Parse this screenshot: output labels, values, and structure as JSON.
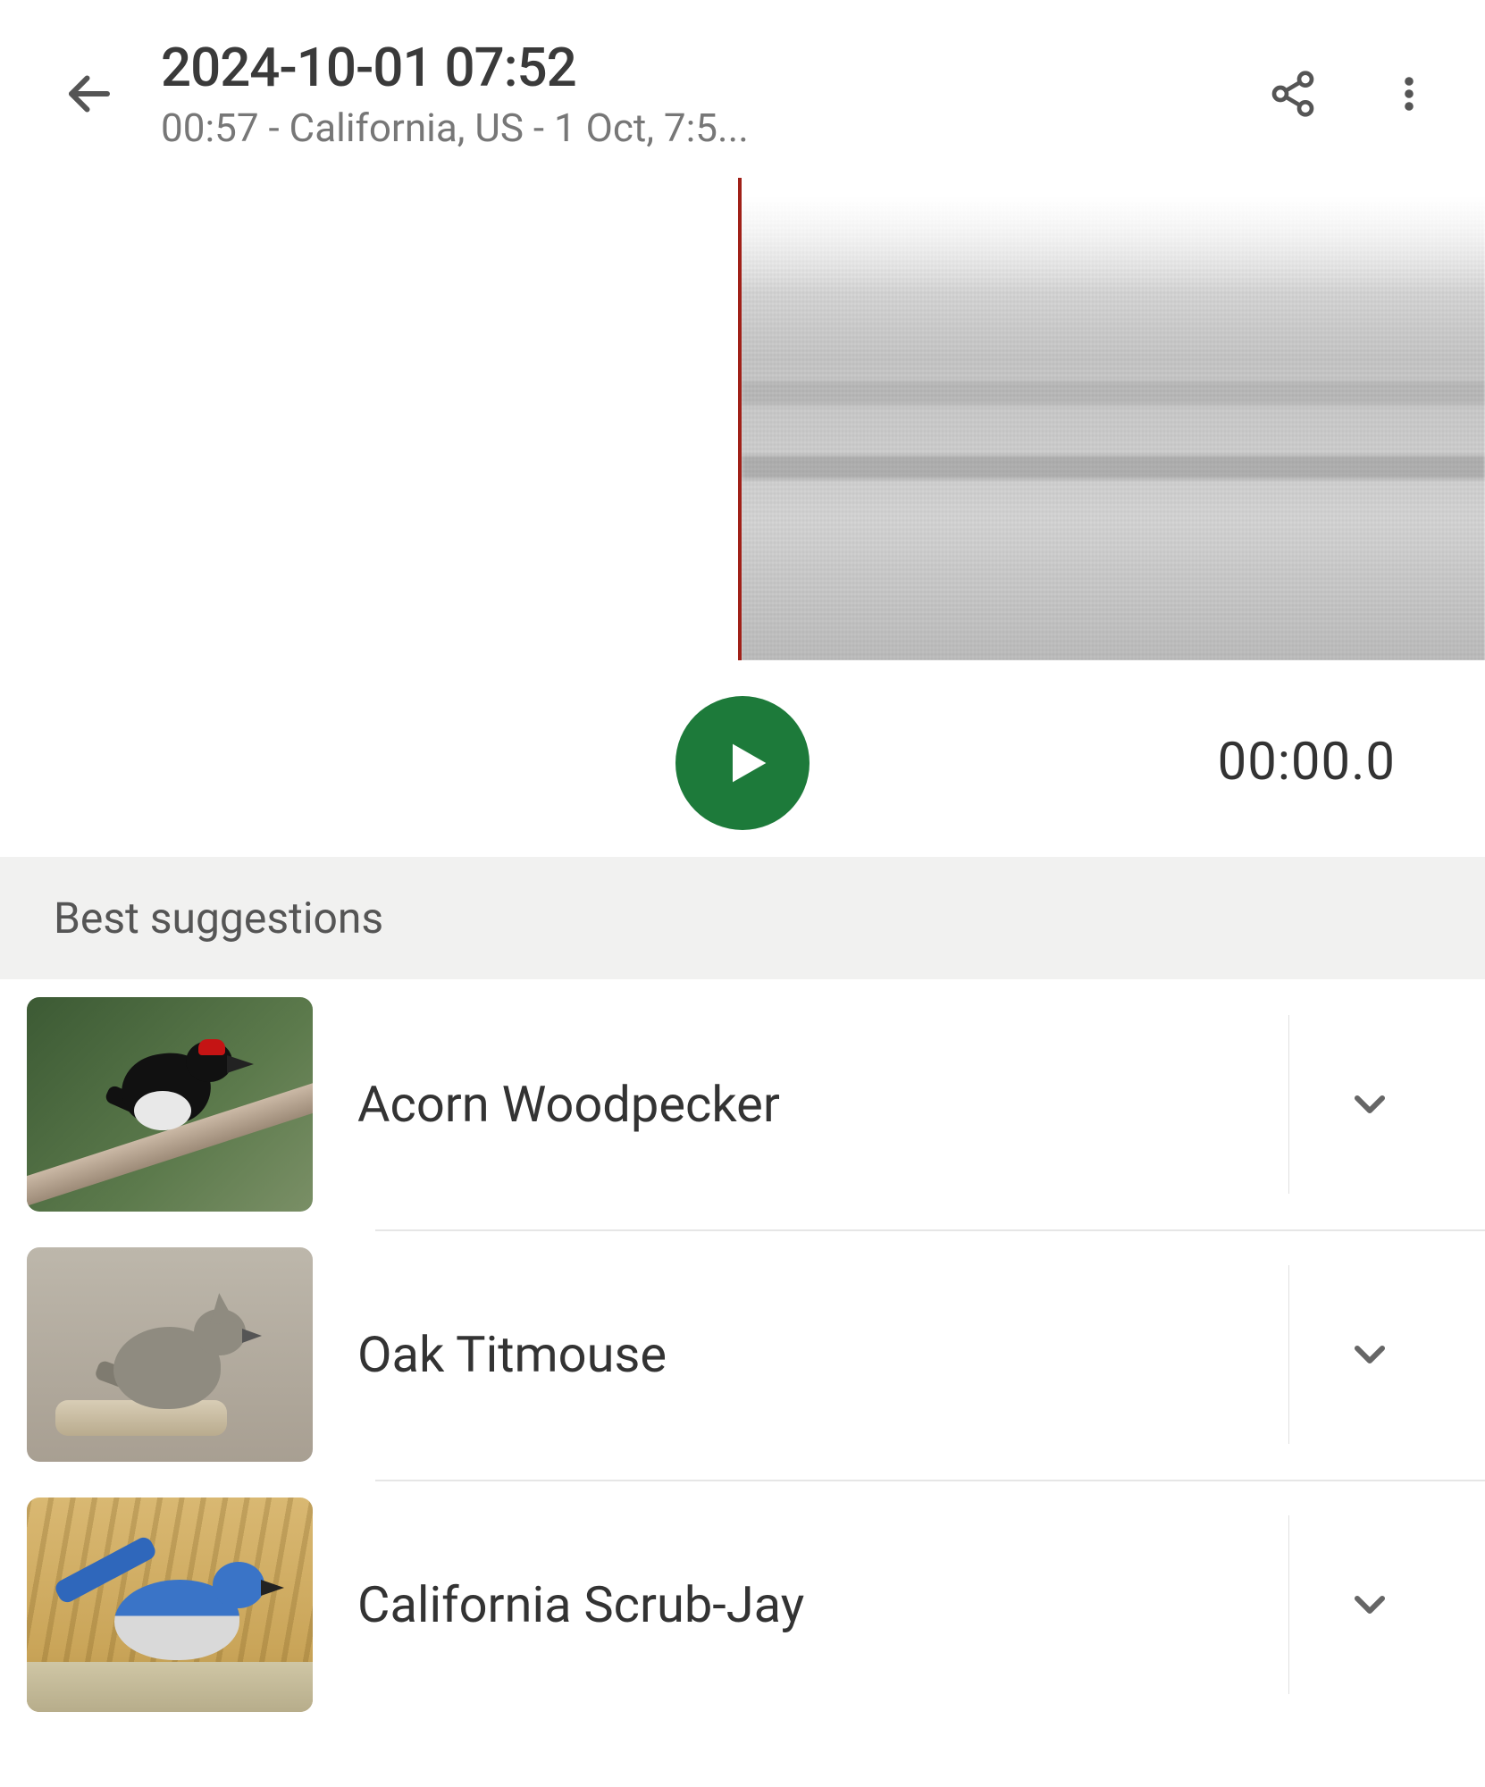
{
  "header": {
    "title": "2024-10-01 07:52",
    "subtitle": "00:57 -               California, US - 1 Oct, 7:5..."
  },
  "player": {
    "time": "00:00.0"
  },
  "sections": {
    "best_label": "Best suggestions"
  },
  "suggestions": [
    {
      "name": "Acorn Woodpecker",
      "thumb": "acorn"
    },
    {
      "name": "Oak Titmouse",
      "thumb": "oak"
    },
    {
      "name": "California Scrub-Jay",
      "thumb": "jay"
    }
  ],
  "icons": {
    "back": "arrow-left",
    "share": "share",
    "more": "more-vertical",
    "play": "play",
    "expand": "chevron-down"
  },
  "colors": {
    "accent_green": "#1d7a3a",
    "playhead_red": "#a02018"
  }
}
